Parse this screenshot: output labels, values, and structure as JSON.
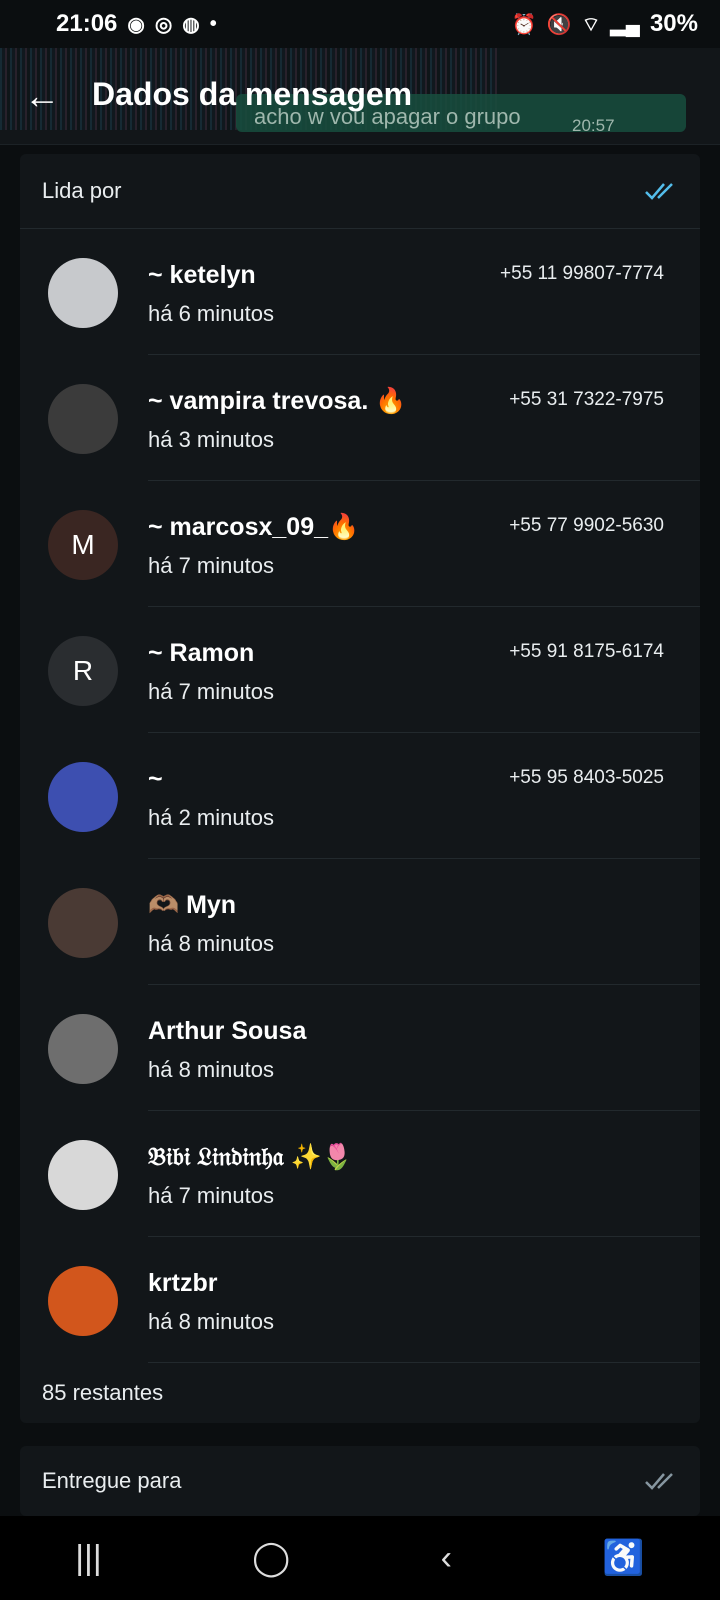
{
  "status": {
    "time": "21:06",
    "battery": "30%"
  },
  "header": {
    "title": "Dados da mensagem",
    "bubble_text": "acho w vou apagar o grupo",
    "bubble_time": "20:57"
  },
  "read_section": {
    "label": "Lida por",
    "readers": [
      {
        "name": "~ ketelyn",
        "time": "há 6 minutos",
        "phone": "+55 11 99807-7774",
        "avatar_letter": "",
        "avatar_color": "#c7c9cc"
      },
      {
        "name": "~ vampira trevosa. 🔥",
        "time": "há 3 minutos",
        "phone": "+55 31 7322-7975",
        "avatar_letter": "",
        "avatar_color": "#3b3b3b"
      },
      {
        "name": "~ marcosx_09_🔥",
        "time": "há 7 minutos",
        "phone": "+55 77 9902-5630",
        "avatar_letter": "M",
        "avatar_color": "#3a2622"
      },
      {
        "name": "~ Ramon",
        "time": "há 7 minutos",
        "phone": "+55 91 8175-6174",
        "avatar_letter": "R",
        "avatar_color": "#2a2d30"
      },
      {
        "name": "~",
        "time": "há 2 minutos",
        "phone": "+55 95 8403-5025",
        "avatar_letter": "",
        "avatar_color": "#3d4fb0"
      },
      {
        "name": "🫶🏽 Myn",
        "time": "há 8 minutos",
        "phone": "",
        "avatar_letter": "",
        "avatar_color": "#4a3a34"
      },
      {
        "name": "Arthur Sousa",
        "time": "há 8 minutos",
        "phone": "",
        "avatar_letter": "",
        "avatar_color": "#6e6e6e"
      },
      {
        "name": "𝔅𝔦𝔟𝔦 𝔏𝔦𝔫𝔡𝔦𝔫𝔥𝔞 ✨🌷",
        "time": "há 7 minutos",
        "phone": "",
        "avatar_letter": "",
        "avatar_color": "#d8d8d8"
      },
      {
        "name": "krtzbr",
        "time": "há 8 minutos",
        "phone": "",
        "avatar_letter": "",
        "avatar_color": "#d2561c"
      }
    ],
    "remaining": "85 restantes"
  },
  "delivered_section": {
    "label": "Entregue para"
  },
  "colors": {
    "read_check": "#53bdeb",
    "delivered_check": "#8696a0"
  }
}
